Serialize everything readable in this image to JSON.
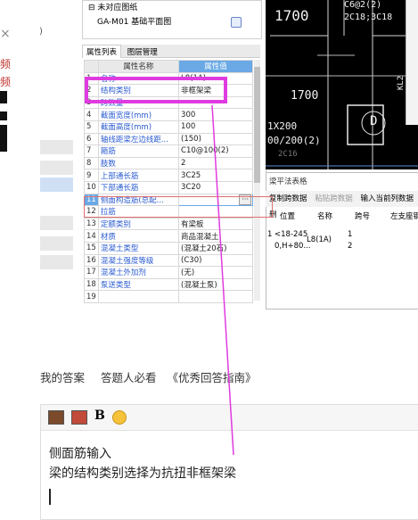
{
  "left": {
    "close_glyph": "×",
    "close_paren": ")",
    "red_chars": [
      "频",
      "频"
    ]
  },
  "tree": {
    "root_label": "未对应图纸",
    "child_label": "GA-M01 基础平面图"
  },
  "panel_tabs": [
    "属性列表",
    "图层管理"
  ],
  "props": {
    "col_name": "属性名称",
    "col_value": "属性值",
    "rows": [
      {
        "i": "1",
        "name": "名称",
        "value": "L8(1A)"
      },
      {
        "i": "2",
        "name": "结构类别",
        "value": "非框架梁"
      },
      {
        "i": "3",
        "name": "跨数量",
        "value": ""
      },
      {
        "i": "4",
        "name": "截面宽度(mm)",
        "value": "300"
      },
      {
        "i": "5",
        "name": "截面高度(mm)",
        "value": "100"
      },
      {
        "i": "6",
        "name": "轴线距梁左边线距...",
        "value": "(150)"
      },
      {
        "i": "7",
        "name": "箍筋",
        "value": "C10@100(2)"
      },
      {
        "i": "8",
        "name": "肢数",
        "value": "2"
      },
      {
        "i": "9",
        "name": "上部通长筋",
        "value": "3C25"
      },
      {
        "i": "10",
        "name": "下部通长筋",
        "value": "3C20"
      },
      {
        "i": "11",
        "name": "侧面构造筋(总配...",
        "value": ""
      },
      {
        "i": "12",
        "name": "拉筋",
        "value": ""
      },
      {
        "i": "13",
        "name": "定额类别",
        "value": "有梁板"
      },
      {
        "i": "14",
        "name": "材质",
        "value": "商品混凝土"
      },
      {
        "i": "15",
        "name": "混凝土类型",
        "value": "(混凝土20石)"
      },
      {
        "i": "16",
        "name": "混凝土强度等级",
        "value": "(C30)"
      },
      {
        "i": "17",
        "name": "混凝土外加剂",
        "value": "(无)"
      },
      {
        "i": "18",
        "name": "泵送类型",
        "value": "(混凝土泵)"
      },
      {
        "i": "19",
        "name": "",
        "value": ""
      }
    ],
    "ellipsis_btn": "···"
  },
  "cad": {
    "t1": "1700",
    "t2": "1700",
    "t3": "C6@2(2)",
    "t4": "2C18;3C18",
    "t5": "1X200",
    "t6": "00/200(2)",
    "t7": "2C16",
    "t8": "D",
    "t9": "KL2"
  },
  "beam": {
    "title": "梁平法表格",
    "toolbar": [
      "复制跨数据",
      "粘贴跨数据",
      "输入当前列数据",
      "删"
    ],
    "headers": [
      "位置",
      "名称",
      "跨号",
      "左支座钢"
    ],
    "row": {
      "idx": "1",
      "pos_a": "<18-245",
      "pos_b": "0,H+80...",
      "name": "L8(1A)",
      "span1": "1",
      "span2": "2"
    }
  },
  "answer": {
    "tab_my": "我的答案",
    "tab_must": "答题人必看",
    "tab_guide": "《优秀回答指南》",
    "bold_label": "B",
    "lines": [
      "侧面筋输入",
      "梁的结构类别选择为抗扭非框架梁"
    ]
  },
  "colors": {
    "annotation": "#e03be0",
    "value_header": "#6aa9e6",
    "link_blue": "#2a5bd0"
  }
}
